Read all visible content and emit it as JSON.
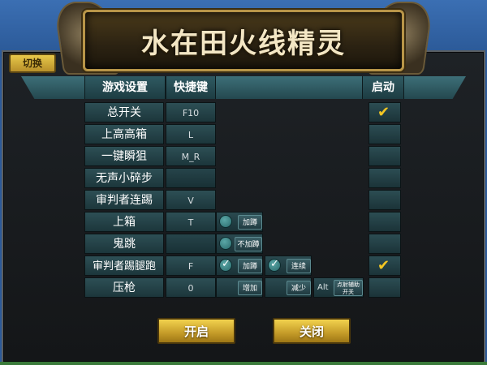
{
  "app": {
    "title": "水在田火线精灵",
    "switch_label": "切换"
  },
  "header": {
    "settings": "游戏设置",
    "hotkey": "快捷键",
    "enable": "启动"
  },
  "rows": [
    {
      "name": "总开关",
      "key": "F10",
      "enabled": true
    },
    {
      "name": "上高高箱",
      "key": "L",
      "enabled": false
    },
    {
      "name": "一键瞬狙",
      "key": "M_R",
      "enabled": false
    },
    {
      "name": "无声小碎步",
      "key": "",
      "enabled": false
    },
    {
      "name": "审判者连踢",
      "key": "V",
      "enabled": false
    },
    {
      "name": "上箱",
      "key": "T",
      "enabled": false,
      "option": "加蹲"
    },
    {
      "name": "鬼跳",
      "key": "",
      "enabled": false,
      "option": "不加蹲"
    },
    {
      "name": "审判者踢腿跑",
      "key": "F",
      "enabled": true,
      "option": "加蹲",
      "option2": "连续"
    },
    {
      "name": "压枪",
      "key": "0",
      "enabled": false,
      "inc": "增加",
      "dec": "减少",
      "alt": "Alt",
      "alt_btn": "点射辅助开关"
    }
  ],
  "footer": {
    "start": "开启",
    "close": "关闭"
  },
  "colors": {
    "accent_gold": "#f3c623",
    "header_teal": "#2f5a62"
  }
}
